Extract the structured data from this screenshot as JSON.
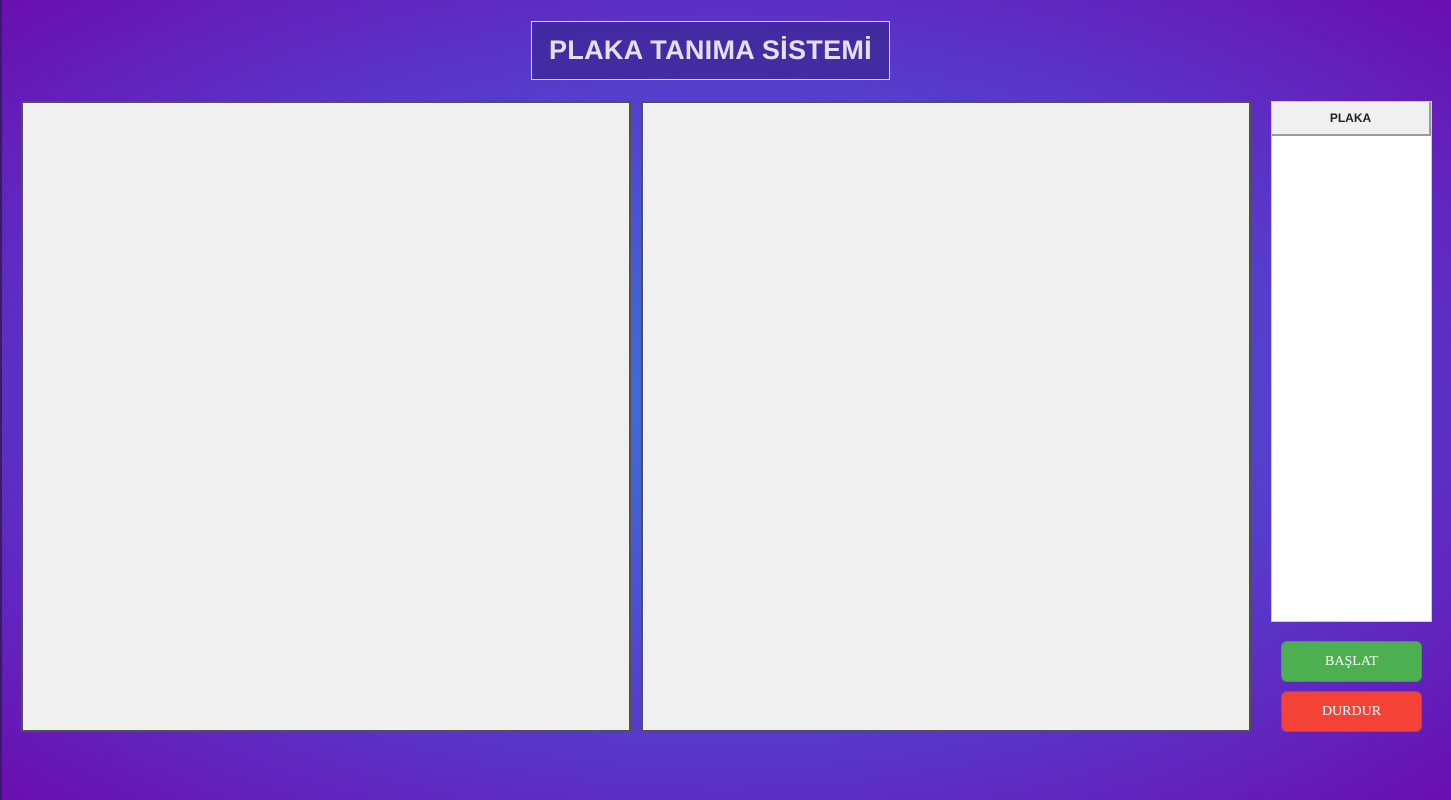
{
  "title": "PLAKA TANIMA SİSTEMİ",
  "plate_table": {
    "column_header": "PLAKA",
    "rows": []
  },
  "buttons": {
    "start_label": "BAŞLAT",
    "stop_label": "DURDUR"
  },
  "colors": {
    "start_button": "#4caf50",
    "stop_button": "#f44336",
    "panel_background": "#f0f0f0"
  }
}
